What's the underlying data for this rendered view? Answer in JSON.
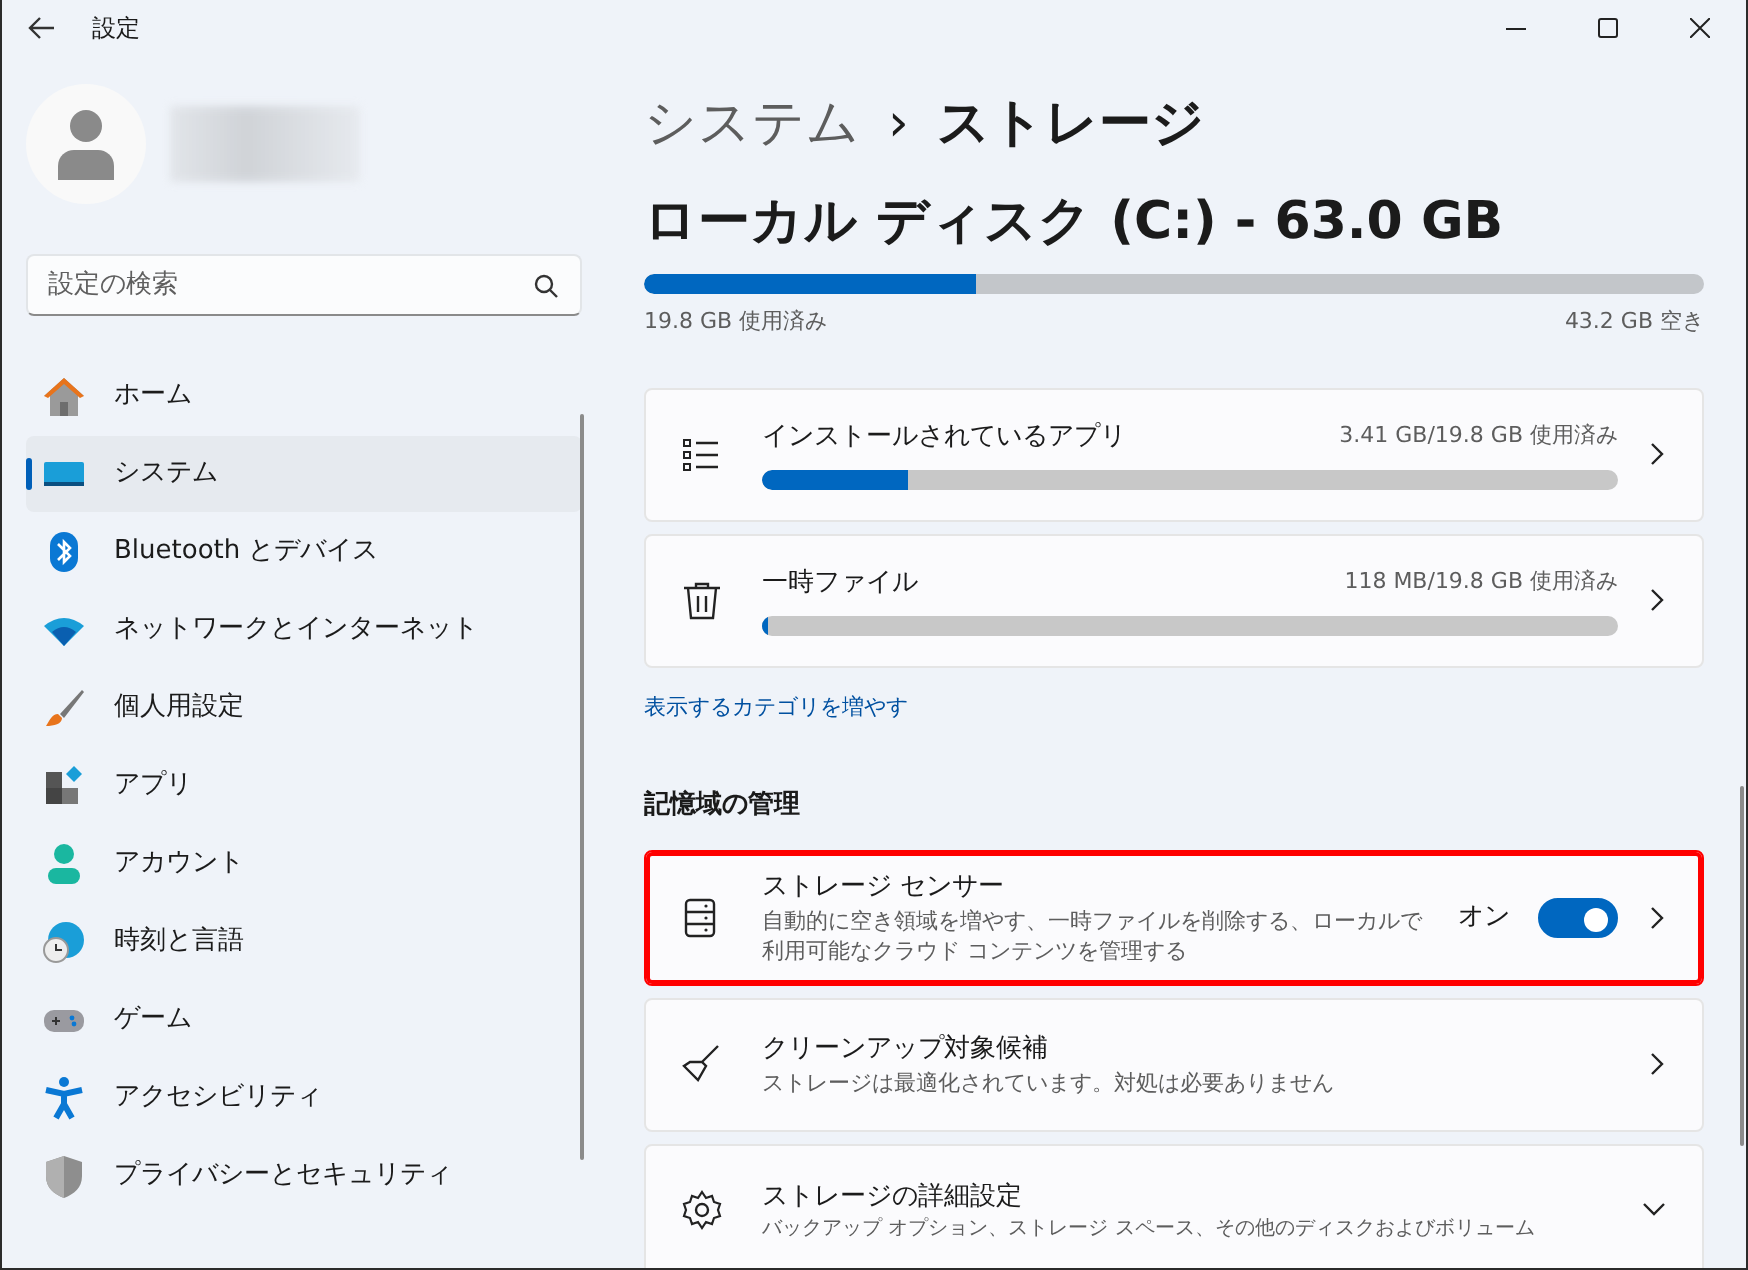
{
  "window": {
    "title": "設定"
  },
  "search": {
    "placeholder": "設定の検索"
  },
  "sidebar": {
    "items": [
      {
        "label": "ホーム",
        "selected": false
      },
      {
        "label": "システム",
        "selected": true
      },
      {
        "label": "Bluetooth とデバイス",
        "selected": false
      },
      {
        "label": "ネットワークとインターネット",
        "selected": false
      },
      {
        "label": "個人用設定",
        "selected": false
      },
      {
        "label": "アプリ",
        "selected": false
      },
      {
        "label": "アカウント",
        "selected": false
      },
      {
        "label": "時刻と言語",
        "selected": false
      },
      {
        "label": "ゲーム",
        "selected": false
      },
      {
        "label": "アクセシビリティ",
        "selected": false
      },
      {
        "label": "プライバシーとセキュリティ",
        "selected": false
      }
    ]
  },
  "breadcrumb": {
    "parent": "システム",
    "separator": "›",
    "current": "ストレージ"
  },
  "disk": {
    "title": "ローカル ディスク (C:) - 63.0 GB",
    "level": 0.314,
    "used": "19.8 GB 使用済み",
    "free": "43.2 GB 空き"
  },
  "categories": [
    {
      "title": "インストールされているアプリ",
      "usage": "3.41 GB/19.8 GB 使用済み",
      "level": 0.17
    },
    {
      "title": "一時ファイル",
      "usage": "118 MB/19.8 GB 使用済み",
      "level": 0.006
    }
  ],
  "more_link": "表示するカテゴリを増やす",
  "management": {
    "heading": "記憶域の管理",
    "items": [
      {
        "kind": "toggle",
        "title": "ストレージ センサー",
        "description": "自動的に空き領域を増やす、一時ファイルを削除する、ローカルで利用可能なクラウド コンテンツを管理する",
        "toggle_label": "オン",
        "on": true,
        "highlighted": true
      },
      {
        "kind": "link",
        "title": "クリーンアップ対象候補",
        "description": "ストレージは最適化されています。対処は必要ありません",
        "highlighted": false
      },
      {
        "kind": "expander",
        "title": "ストレージの詳細設定",
        "description": "バックアップ オプション、ストレージ スペース、その他のディスクおよびボリューム",
        "highlighted": false
      }
    ]
  }
}
